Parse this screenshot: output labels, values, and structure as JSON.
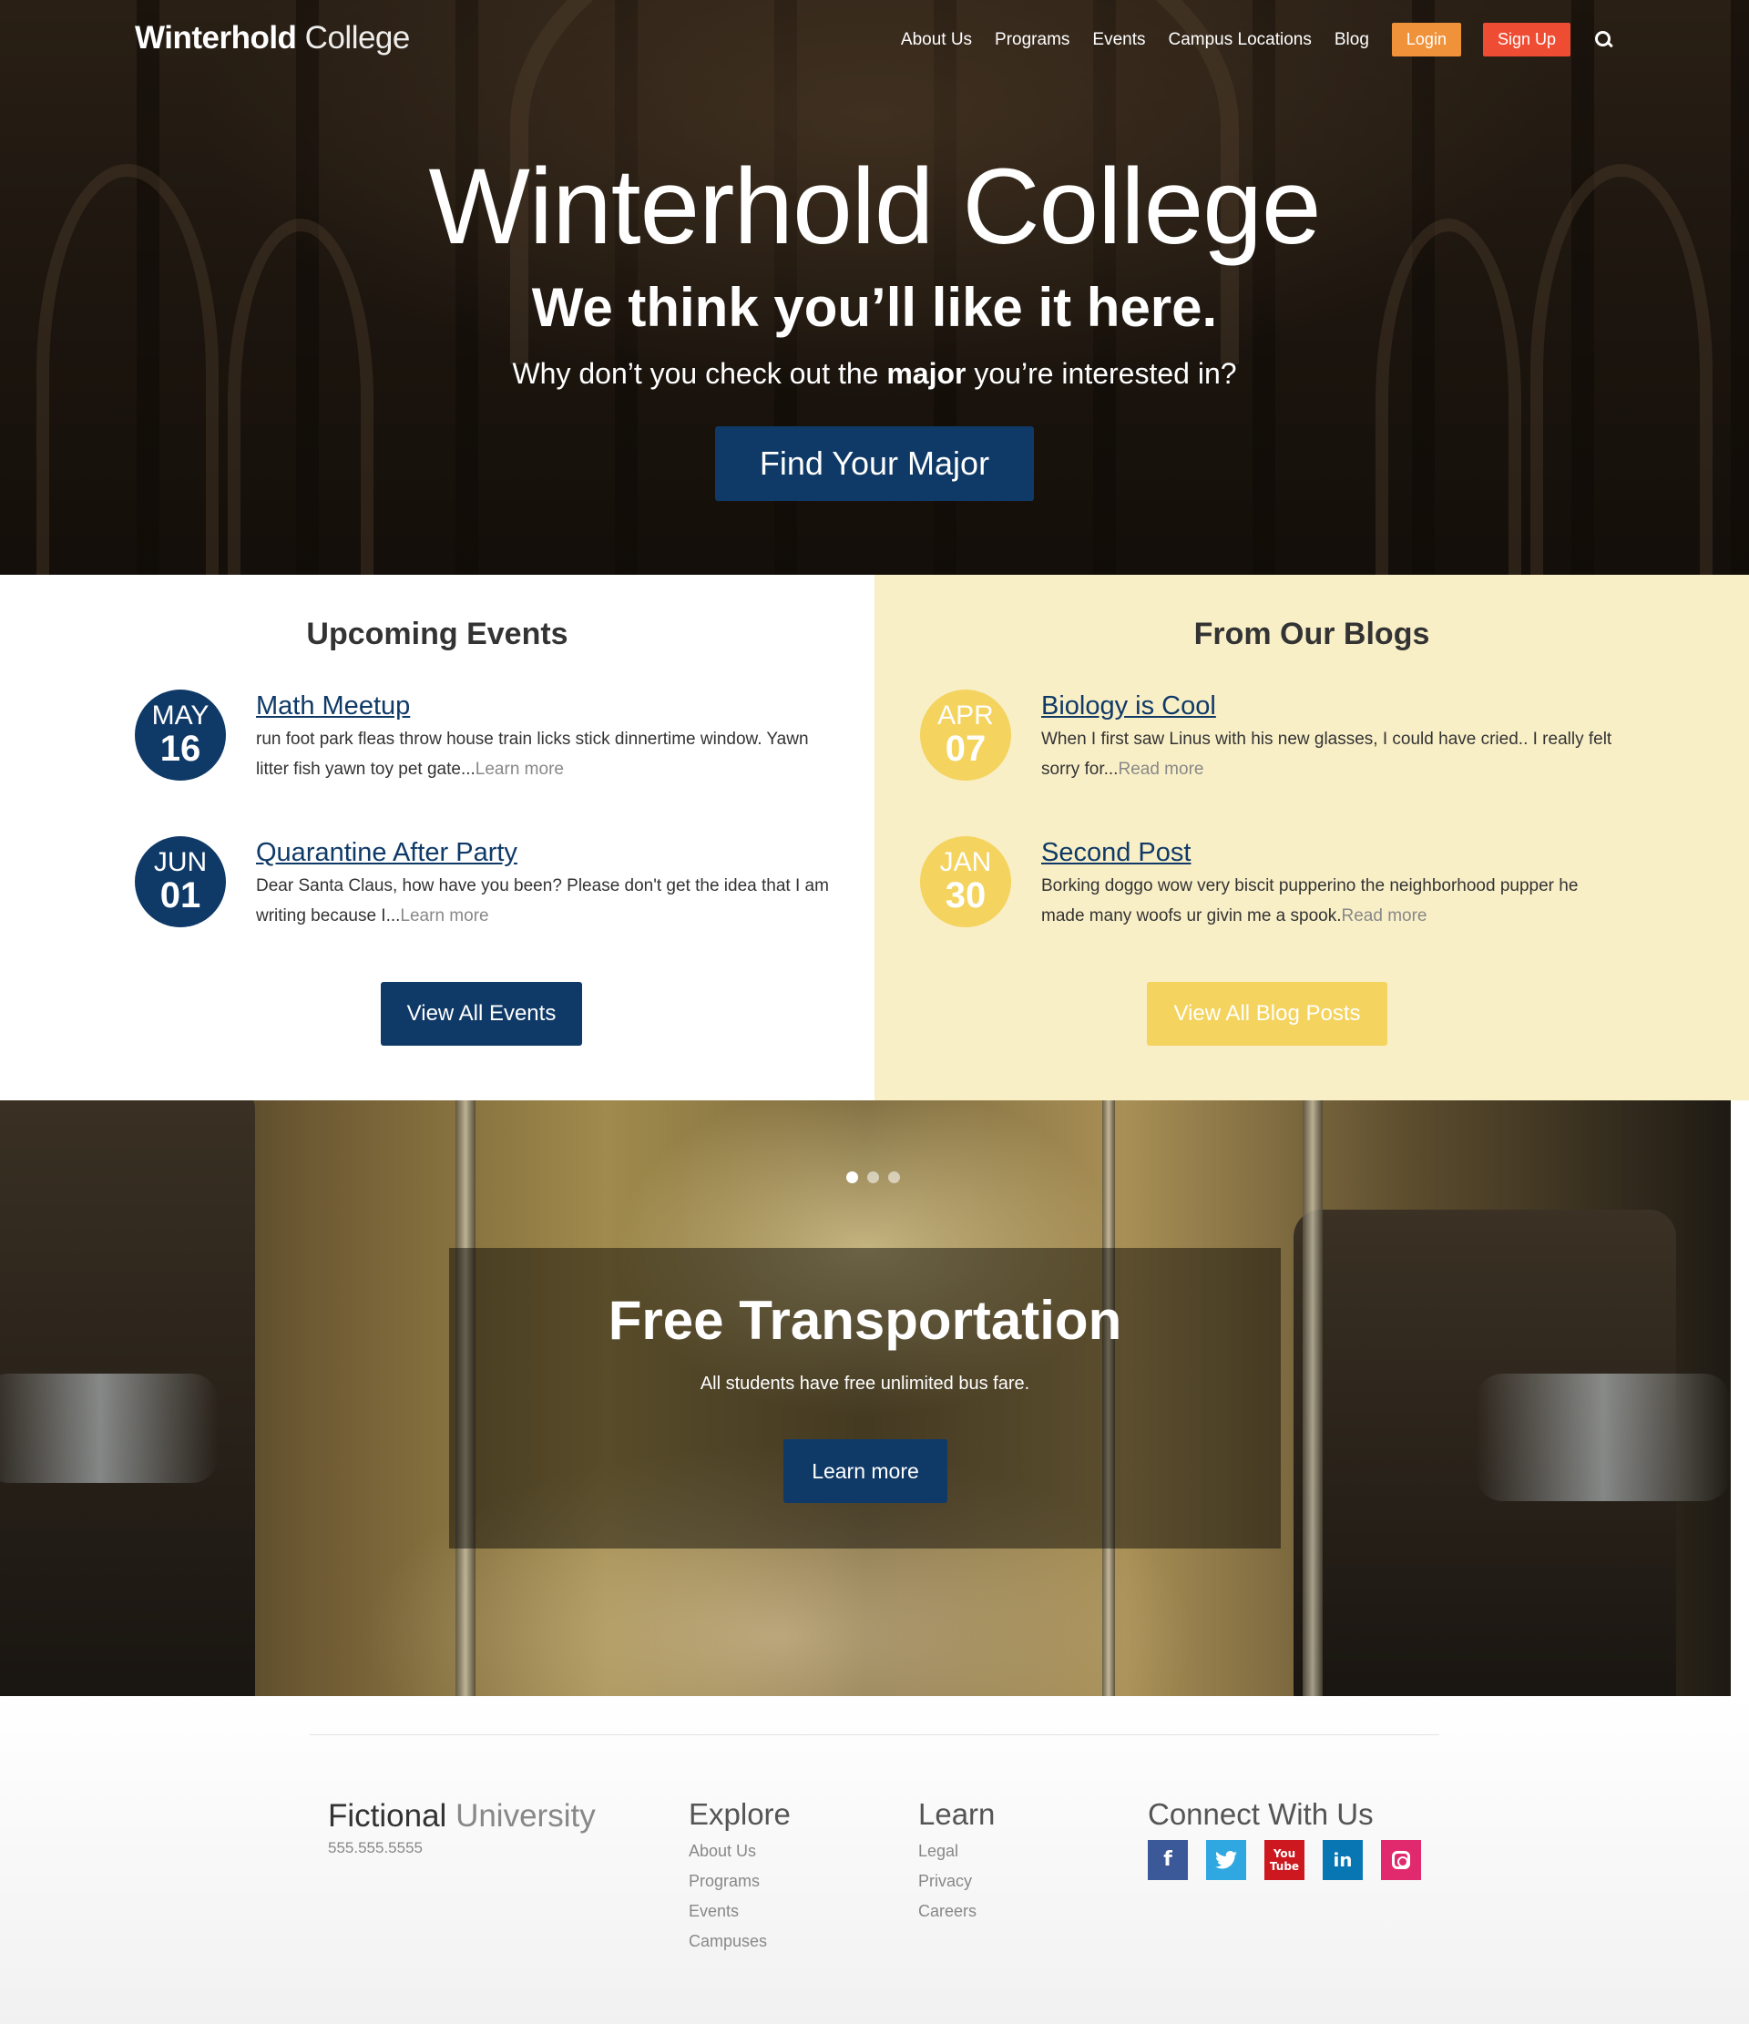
{
  "header": {
    "logo_strong": "Winterhold",
    "logo_light": "College",
    "nav": [
      "About Us",
      "Programs",
      "Events",
      "Campus Locations",
      "Blog"
    ],
    "login_label": "Login",
    "signup_label": "Sign Up",
    "search_icon": "search-icon"
  },
  "hero": {
    "title": "Winterhold College",
    "subtitle": "We think you’ll like it here.",
    "text_before": "Why don’t you check out the ",
    "text_bold": "major",
    "text_after": " you’re interested in?",
    "button_label": "Find Your Major"
  },
  "events": {
    "title": "Upcoming Events",
    "items": [
      {
        "month": "MAY",
        "day": "16",
        "title": "Math Meetup",
        "text": "run foot park fleas throw house train licks stick dinnertime window. Yawn litter fish yawn toy pet gate...",
        "link": "Learn more"
      },
      {
        "month": "JUN",
        "day": "01",
        "title": "Quarantine After Party",
        "text": "Dear Santa Claus, how have you been? Please don't get the idea that I am writing because I...",
        "link": "Learn more"
      }
    ],
    "button_label": "View All Events"
  },
  "blogs": {
    "title": "From Our Blogs",
    "items": [
      {
        "month": "APR",
        "day": "07",
        "title": "Biology is Cool",
        "text": "When I first saw Linus with his new glasses, I could have cried.. I really felt sorry for...",
        "link": "Read more"
      },
      {
        "month": "JAN",
        "day": "30",
        "title": "Second Post",
        "text": "Borking doggo wow very biscit pupperino the neighborhood pupper he made many woofs ur givin me a spook.",
        "link": "Read more"
      }
    ],
    "button_label": "View All Blog Posts"
  },
  "slider": {
    "dots": 3,
    "active_dot": 1,
    "title": "Free Transportation",
    "text": "All students have free unlimited bus fare.",
    "button_label": "Learn more"
  },
  "footer": {
    "logo_strong": "Fictional",
    "logo_light": "University",
    "phone": "555.555.5555",
    "explore": {
      "title": "Explore",
      "links": [
        "About Us",
        "Programs",
        "Events",
        "Campuses"
      ]
    },
    "learn": {
      "title": "Learn",
      "links": [
        "Legal",
        "Privacy",
        "Careers"
      ]
    },
    "connect": {
      "title": "Connect With Us",
      "social": [
        "facebook-icon",
        "twitter-icon",
        "youtube-icon",
        "linkedin-icon",
        "instagram-icon"
      ]
    }
  },
  "colors": {
    "primary": "#0f3a68",
    "accent_yellow": "#f4d35e",
    "blog_bg": "#f9efc7",
    "login": "#f0923a",
    "signup": "#ef4d33"
  }
}
